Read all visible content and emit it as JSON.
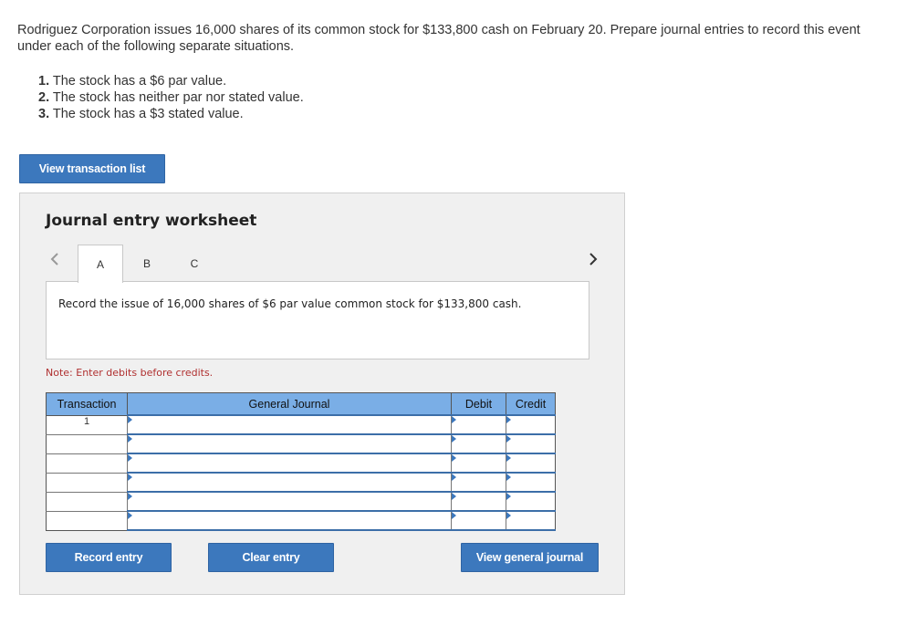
{
  "problem": {
    "text": "Rodriguez Corporation issues 16,000 shares of its common stock for $133,800 cash on February 20. Prepare journal entries to record this event under each of the following separate situations.",
    "requirements": [
      {
        "num": "1.",
        "text": "The stock has a $6 par value."
      },
      {
        "num": "2.",
        "text": "The stock has neither par nor stated value."
      },
      {
        "num": "3.",
        "text": "The stock has a $3 stated value."
      }
    ]
  },
  "buttons": {
    "view_transaction_list": "View transaction list",
    "record_entry": "Record entry",
    "clear_entry": "Clear entry",
    "view_general_journal": "View general journal"
  },
  "worksheet": {
    "title": "Journal entry worksheet",
    "tabs": [
      "A",
      "B",
      "C"
    ],
    "active_tab": "A",
    "instruction": "Record the issue of 16,000 shares of $6 par value common stock for $133,800 cash.",
    "note": "Note: Enter debits before credits.",
    "columns": [
      "Transaction",
      "General Journal",
      "Debit",
      "Credit"
    ],
    "rows": [
      {
        "transaction": "1",
        "account": "",
        "debit": "",
        "credit": ""
      },
      {
        "transaction": "",
        "account": "",
        "debit": "",
        "credit": ""
      },
      {
        "transaction": "",
        "account": "",
        "debit": "",
        "credit": ""
      },
      {
        "transaction": "",
        "account": "",
        "debit": "",
        "credit": ""
      },
      {
        "transaction": "",
        "account": "",
        "debit": "",
        "credit": ""
      },
      {
        "transaction": "",
        "account": "",
        "debit": "",
        "credit": ""
      }
    ]
  },
  "icons": {
    "prev": "chevron-left-icon",
    "next": "chevron-right-icon"
  },
  "colors": {
    "accent": "#3c78bd",
    "header": "#7aaee6",
    "note": "#b03030",
    "panel": "#f0f0f0"
  }
}
